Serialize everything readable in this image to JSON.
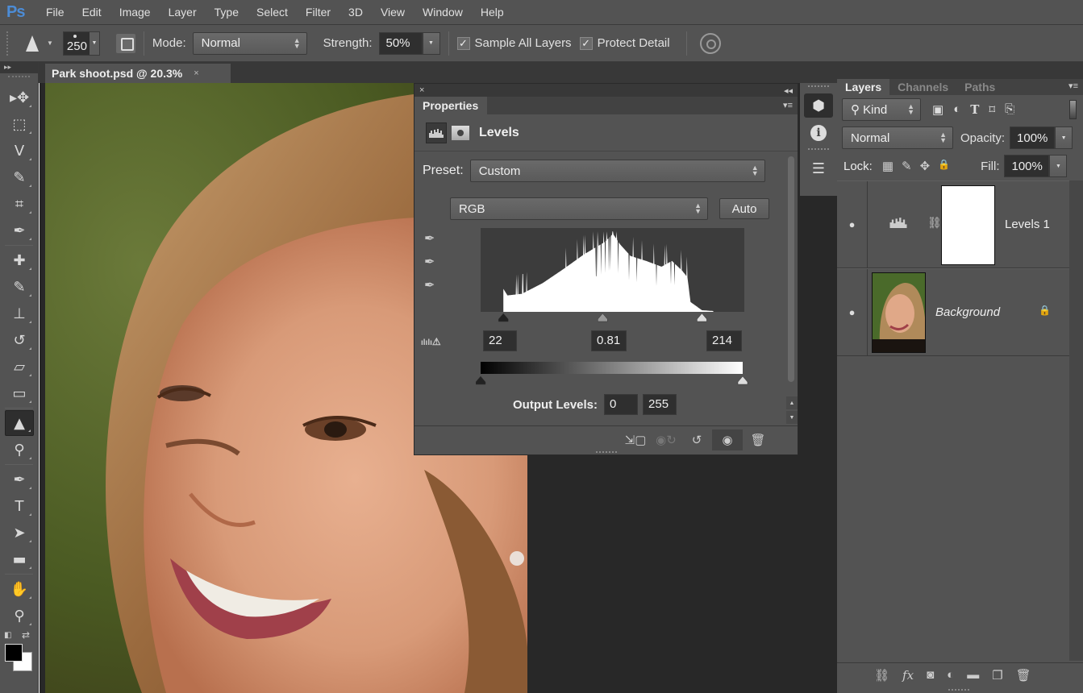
{
  "app": {
    "logo": "Ps",
    "menu": [
      "File",
      "Edit",
      "Image",
      "Layer",
      "Type",
      "Select",
      "Filter",
      "3D",
      "View",
      "Window",
      "Help"
    ]
  },
  "options_bar": {
    "tool_icon": "sharpen-tool-icon",
    "brush_size": "250",
    "mode_label": "Mode:",
    "mode_value": "Normal",
    "strength_label": "Strength:",
    "strength_value": "50%",
    "sample_all_layers_label": "Sample All Layers",
    "sample_all_layers_checked": true,
    "protect_detail_label": "Protect Detail",
    "protect_detail_checked": true,
    "check_mark": "✓"
  },
  "document": {
    "tab_title": "Park shoot.psd @ 20.3%",
    "close_glyph": "×"
  },
  "toolbox": {
    "collapse_glyph": "▸▸",
    "tools": [
      {
        "name": "move-tool",
        "glyph": "▸✥"
      },
      {
        "name": "marquee-tool",
        "glyph": "⬚"
      },
      {
        "name": "lasso-tool",
        "glyph": "ᐯ"
      },
      {
        "name": "quick-selection-tool",
        "glyph": "✎"
      },
      {
        "name": "crop-tool",
        "glyph": "⌗"
      },
      {
        "name": "eyedropper-tool",
        "glyph": "✒"
      },
      {
        "name": "healing-brush-tool",
        "glyph": "✚"
      },
      {
        "name": "brush-tool",
        "glyph": "✎"
      },
      {
        "name": "clone-stamp-tool",
        "glyph": "⊥"
      },
      {
        "name": "history-brush-tool",
        "glyph": "↺"
      },
      {
        "name": "eraser-tool",
        "glyph": "▱"
      },
      {
        "name": "gradient-tool",
        "glyph": "▭"
      },
      {
        "name": "sharpen-tool",
        "glyph": "▲"
      },
      {
        "name": "dodge-tool",
        "glyph": "⚲"
      },
      {
        "name": "pen-tool",
        "glyph": "✒"
      },
      {
        "name": "type-tool",
        "glyph": "T"
      },
      {
        "name": "path-selection-tool",
        "glyph": "➤"
      },
      {
        "name": "rectangle-tool",
        "glyph": "▬"
      },
      {
        "name": "hand-tool",
        "glyph": "✋"
      },
      {
        "name": "zoom-tool",
        "glyph": "⚲"
      }
    ],
    "active_tool": "sharpen-tool",
    "foreground_color": "#000000",
    "background_color": "#ffffff"
  },
  "properties": {
    "close_glyph": "×",
    "collapse_glyph": "◂◂",
    "tab_label": "Properties",
    "panel_menu_glyph": "▾≡",
    "title": "Levels",
    "preset_label": "Preset:",
    "preset_value": "Custom",
    "channel_value": "RGB",
    "auto_label": "Auto",
    "input_black": "22",
    "input_gamma": "0.81",
    "input_white": "214",
    "output_label": "Output Levels:",
    "output_black": "0",
    "output_white": "255",
    "clip_icon_glyph": "⚠",
    "histogram_range": [
      0,
      255
    ],
    "input_black_level": 22,
    "input_gamma_level": 0.81,
    "input_white_level": 214,
    "footer_icons": [
      "clip-to-layer-icon",
      "view-previous-state-icon",
      "reset-icon",
      "visibility-icon",
      "delete-icon"
    ]
  },
  "layers_panel": {
    "tabs": [
      "Layers",
      "Channels",
      "Paths"
    ],
    "active_tab": "Layers",
    "panel_menu_glyph": "▾≡",
    "filter_kind": "Kind",
    "filter_search_glyph": "⚲",
    "filter_icons": [
      "▣",
      "◐",
      "T",
      "⌑",
      "⎘"
    ],
    "blend_mode": "Normal",
    "opacity_label": "Opacity:",
    "opacity_value": "100%",
    "lock_label": "Lock:",
    "lock_icons": [
      "▦",
      "✎",
      "✥",
      "🔒"
    ],
    "fill_label": "Fill:",
    "fill_value": "100%",
    "layers": [
      {
        "name": "Levels 1",
        "visible": true,
        "type": "adjustment",
        "eye": "●",
        "link": "⛓"
      },
      {
        "name": "Background",
        "visible": true,
        "type": "image",
        "locked": true,
        "eye": "●",
        "lock": "🔒"
      }
    ],
    "footer_icons": [
      "⛓",
      "fx",
      "◙",
      "◐",
      "▬",
      "❐",
      "🗑"
    ]
  },
  "dock": {
    "icons": [
      "3d-panel-icon",
      "info-icon",
      "clone-source-icon"
    ],
    "info_glyph": "i"
  }
}
